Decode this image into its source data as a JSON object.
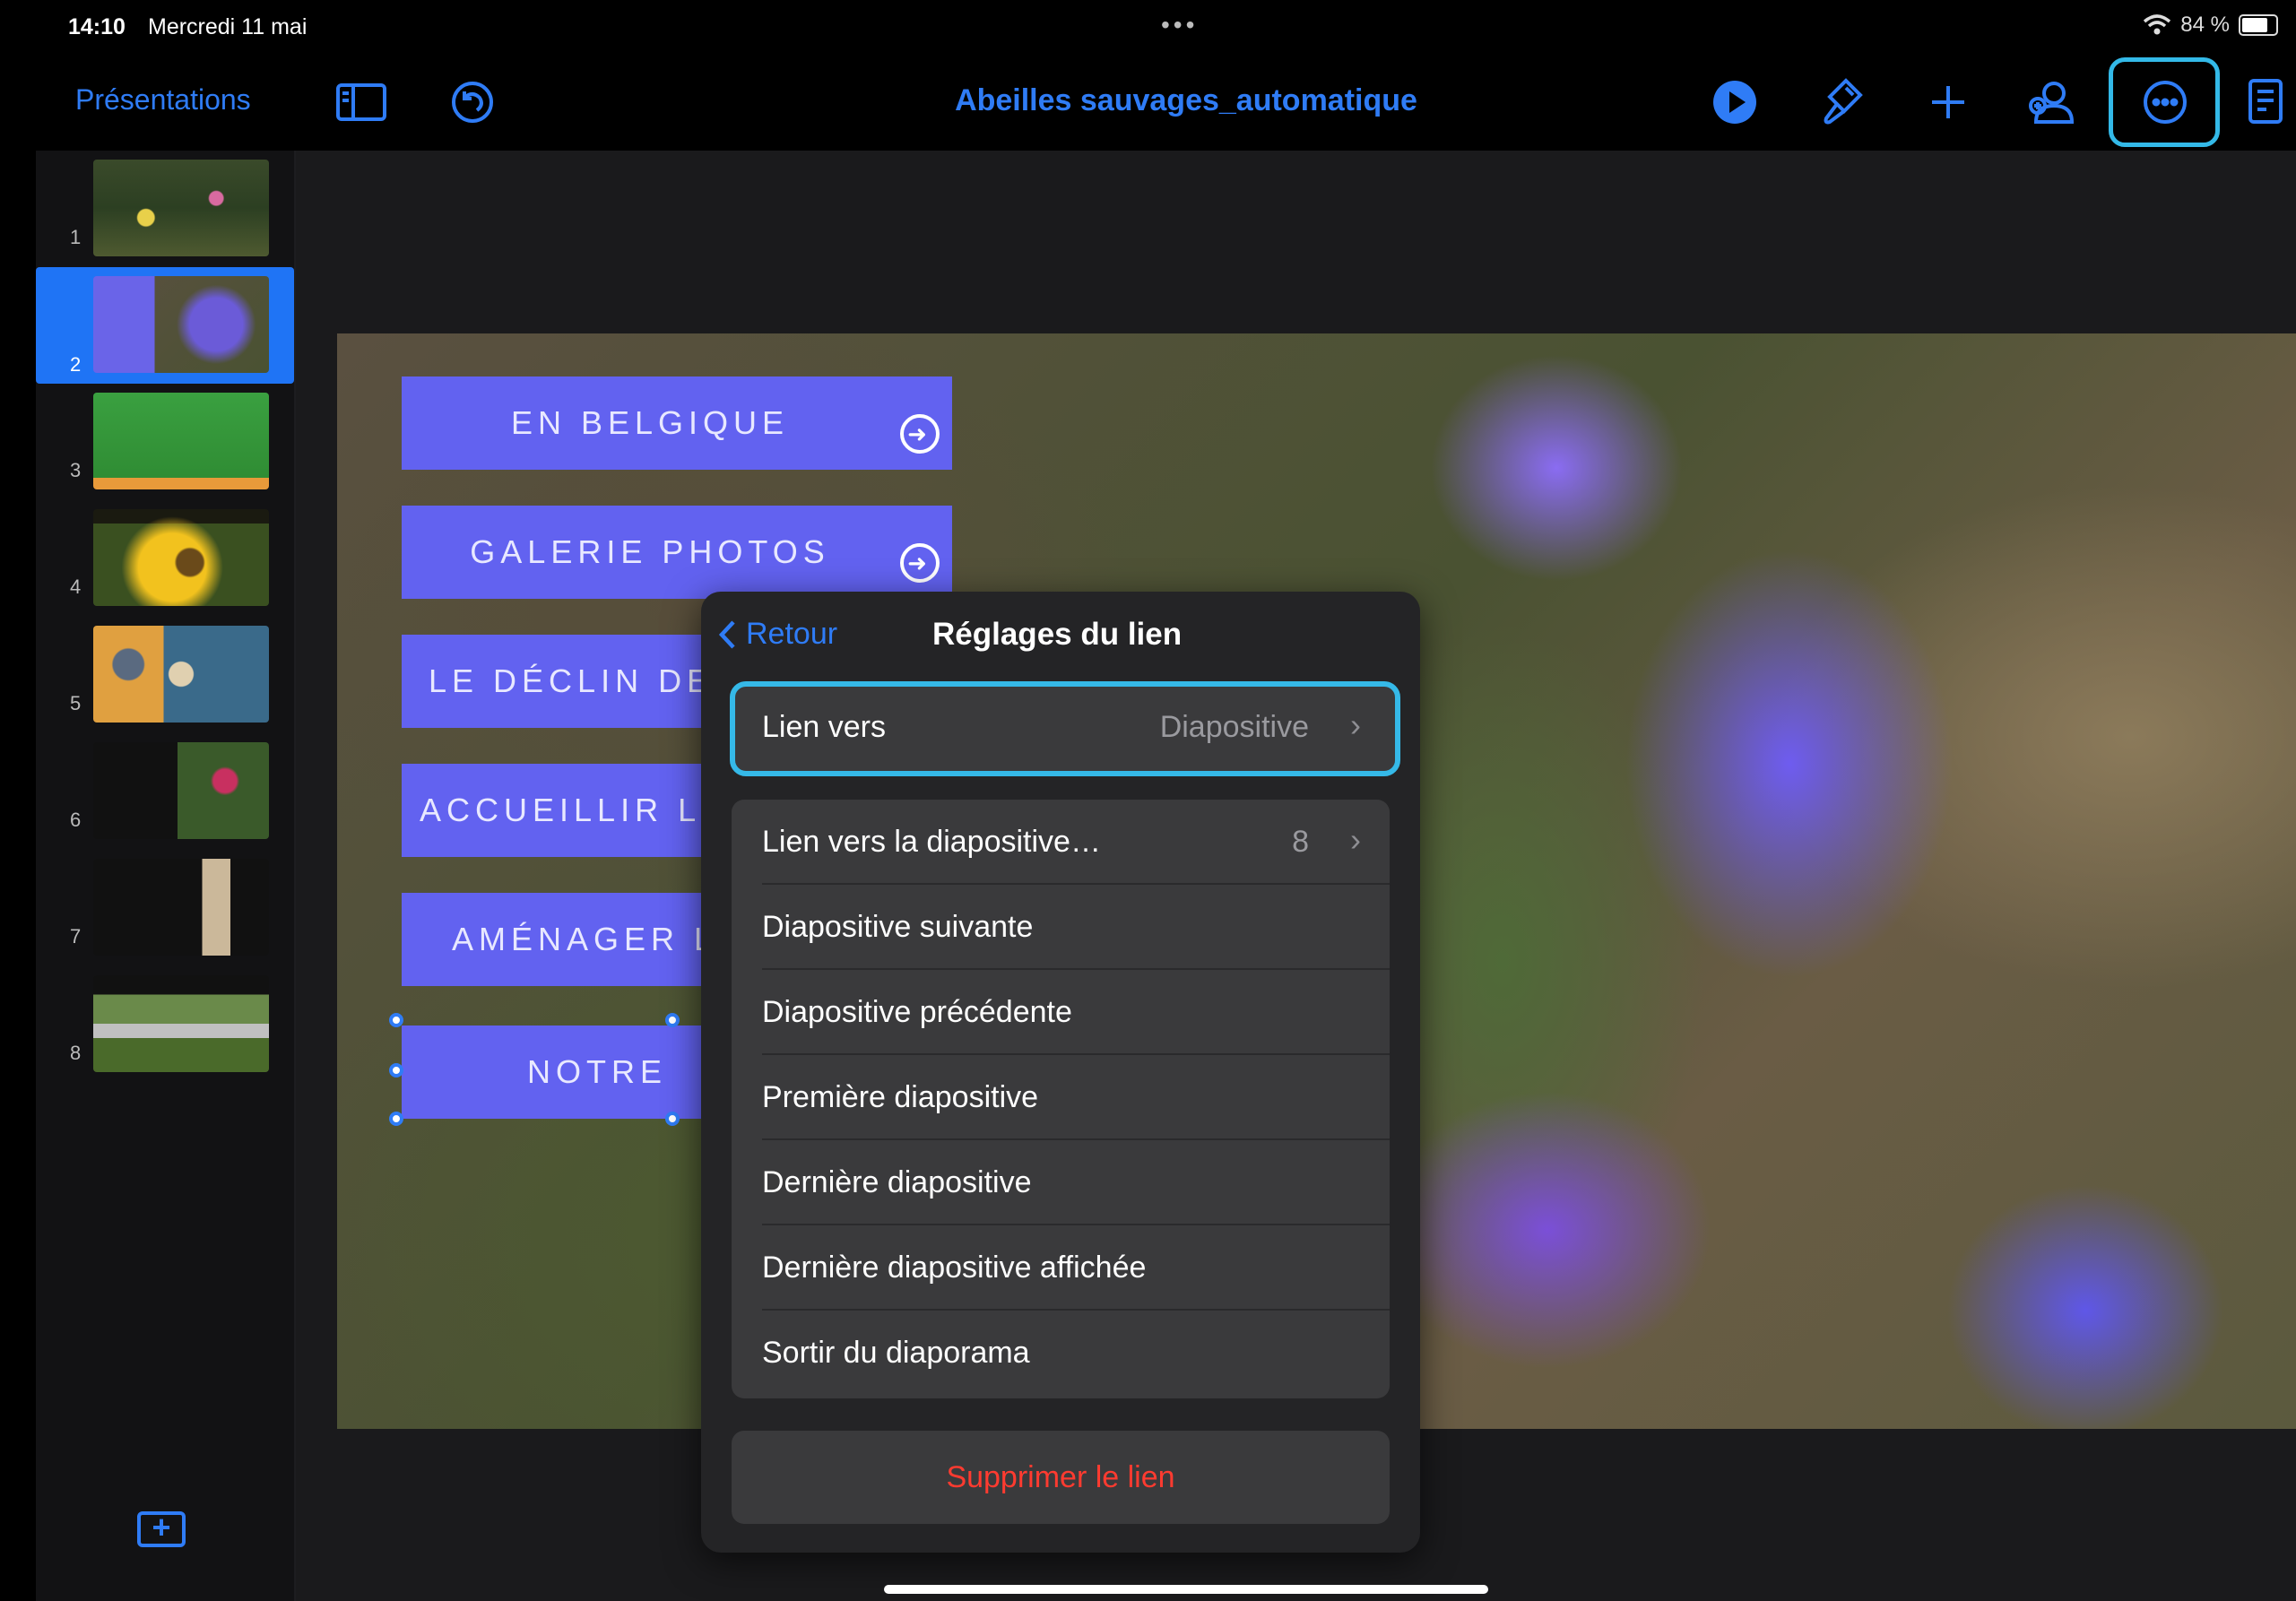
{
  "status_bar": {
    "time": "14:10",
    "date": "Mercredi 11 mai",
    "dots": "•••",
    "battery": "84 %"
  },
  "toolbar": {
    "presentations_label": "Présentations",
    "document_title": "Abeilles sauvages_automatique"
  },
  "sidebar": {
    "slides": [
      {
        "number": "1"
      },
      {
        "number": "2"
      },
      {
        "number": "3"
      },
      {
        "number": "4"
      },
      {
        "number": "5"
      },
      {
        "number": "6"
      },
      {
        "number": "7"
      },
      {
        "number": "8"
      }
    ],
    "add_slide_label": "+"
  },
  "slide": {
    "buttons": [
      {
        "label": "EN BELGIQUE"
      },
      {
        "label": "GALERIE PHOTOS"
      },
      {
        "label": "LE DÉCLIN DE"
      },
      {
        "label": "ACCUEILLIR LE"
      },
      {
        "label": "AMÉNAGER L"
      },
      {
        "label": "NOTRE"
      }
    ]
  },
  "popover": {
    "back_label": "Retour",
    "title": "Réglages du lien",
    "link_to": {
      "label": "Lien vers",
      "value": "Diapositive"
    },
    "options": [
      {
        "label": "Lien vers la diapositive…",
        "value": "8"
      },
      {
        "label": "Diapositive suivante"
      },
      {
        "label": "Diapositive précédente"
      },
      {
        "label": "Première diapositive"
      },
      {
        "label": "Dernière diapositive"
      },
      {
        "label": "Dernière diapositive affichée"
      },
      {
        "label": "Sortir du diaporama"
      }
    ],
    "delete_label": "Supprimer le lien"
  },
  "colors": {
    "accent": "#2f7cf6",
    "highlight": "#35b9e8",
    "destructive": "#ff3b30",
    "slide_button": "#6262f0"
  }
}
